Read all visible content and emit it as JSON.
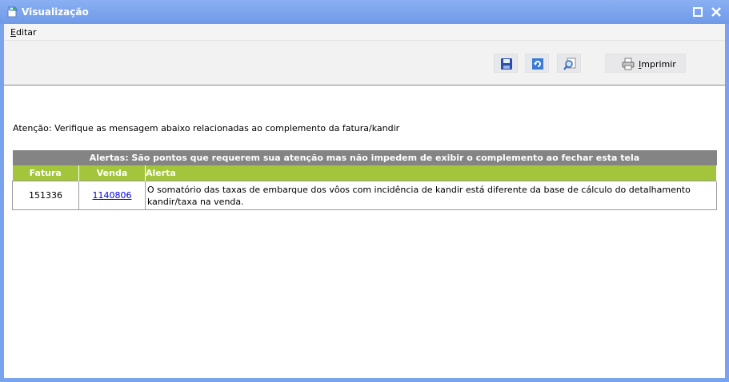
{
  "window": {
    "title": "Visualização"
  },
  "menu": {
    "items": [
      "Editar"
    ],
    "accelerator": "E",
    "rest": "ditar"
  },
  "toolbar": {
    "print_label": "Imprimir",
    "print_accel": "I",
    "print_rest": "mprimir"
  },
  "content": {
    "notice": "Atenção: Verifique as mensagem abaixo relacionadas ao complemento da fatura/kandir",
    "table_title": "Alertas: São pontos que requerem sua atenção mas não impedem de exibir o complemento ao fechar esta tela",
    "columns": [
      "Fatura",
      "Venda",
      "Alerta"
    ],
    "rows": [
      {
        "fatura": "151336",
        "venda": "1140806",
        "alerta": "O somatório das taxas de embarque dos vôos com incidência de kandir está diferente da base de cálculo do detalhamento kandir/taxa na venda."
      }
    ]
  },
  "colors": {
    "titlebar": "#7aa3ee",
    "table_title_bg": "#848484",
    "column_header_bg": "#a2c53b",
    "link": "#0000ee"
  }
}
